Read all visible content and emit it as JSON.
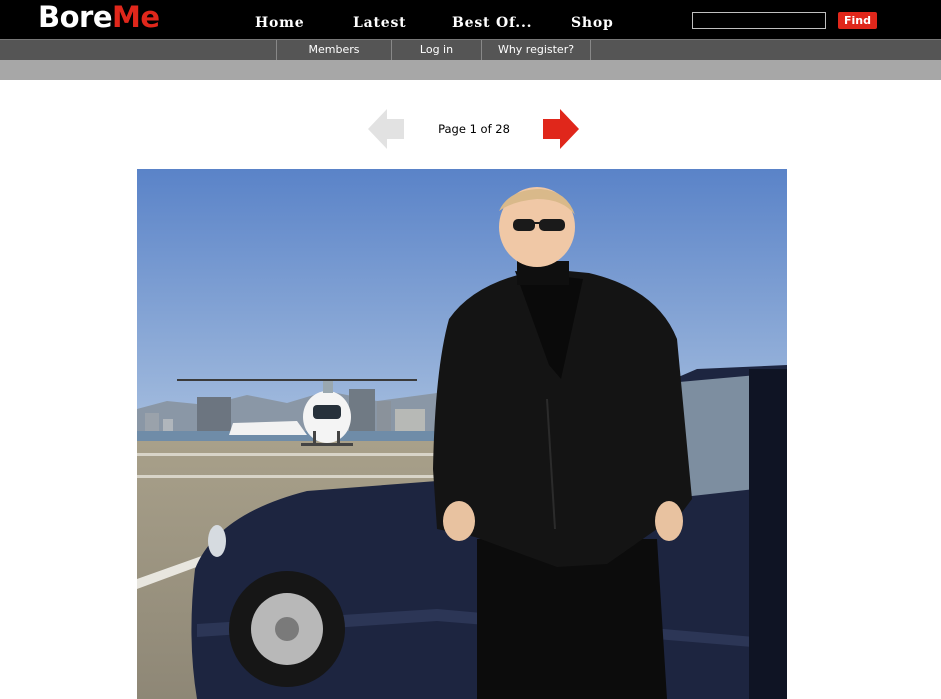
{
  "logo": {
    "part1": "Bore",
    "part2": "Me"
  },
  "nav": {
    "items": [
      {
        "label": "Home"
      },
      {
        "label": "Latest"
      },
      {
        "label": "Best Of..."
      },
      {
        "label": "Shop"
      }
    ]
  },
  "search": {
    "value": "",
    "button_label": "Find"
  },
  "subnav": {
    "items": [
      {
        "label": "Members"
      },
      {
        "label": "Log in"
      },
      {
        "label": "Why register?"
      }
    ]
  },
  "pager": {
    "text": "Page 1 of 28",
    "current_page": 1,
    "total_pages": 28,
    "prev_icon": "left-arrow-icon",
    "next_icon": "right-arrow-icon"
  },
  "colors": {
    "header_bg": "#000000",
    "accent": "#e0271b",
    "subnav_bg": "#555555",
    "graybar": "#a7a7a7",
    "prev_arrow": "#e2e2e2"
  }
}
